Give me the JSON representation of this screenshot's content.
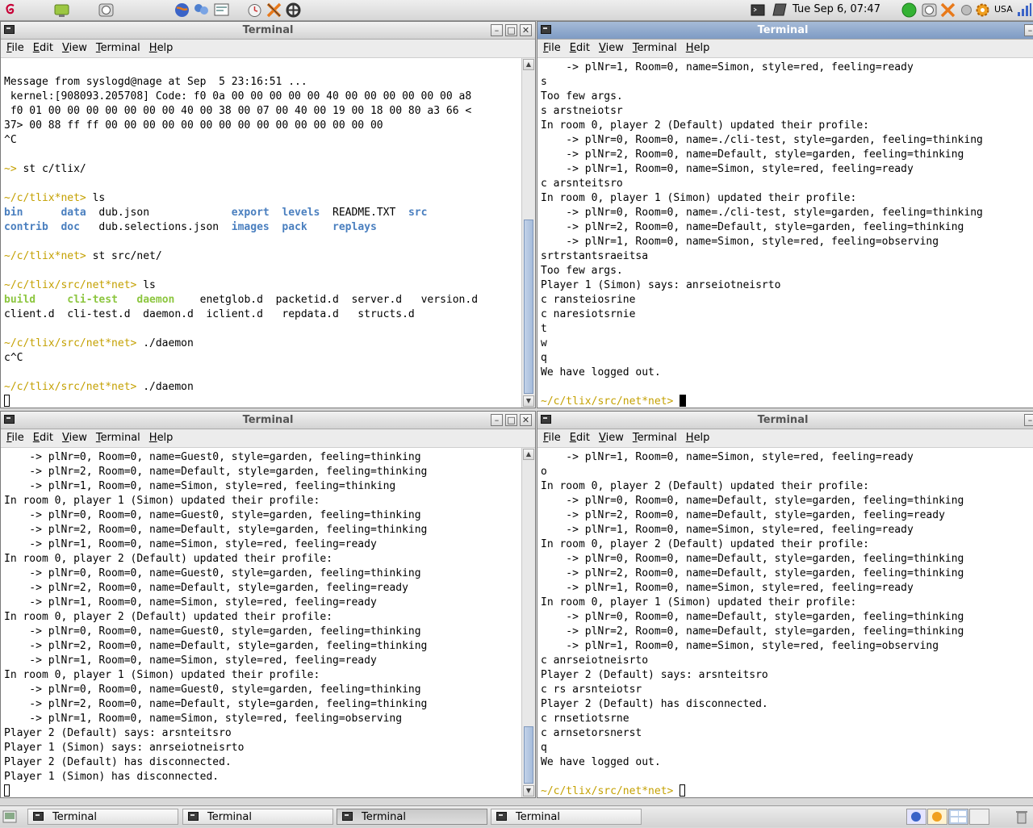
{
  "top_panel": {
    "clock": "Tue Sep  6, 07:47",
    "keyboard_layout": "USA",
    "launcher_icons": [
      "debian-menu-icon",
      "monitor-icon",
      "hardware-icon",
      "web-browser-icon",
      "chat-icon",
      "screenshot-icon",
      "timer-icon",
      "tools-icon",
      "fan-icon"
    ],
    "tray_icons": [
      "terminal-tray-icon",
      "notes-icon",
      "status-green-icon",
      "hardware-tray-icon",
      "tools-tray-icon",
      "bulb-icon",
      "settings-icon",
      "signal-icon"
    ]
  },
  "windows": [
    {
      "title": "Terminal",
      "menu": [
        "File",
        "Edit",
        "View",
        "Terminal",
        "Help"
      ],
      "lines": [
        [
          {
            "t": ""
          }
        ],
        [
          {
            "t": "Message from syslogd@nage at Sep  5 23:16:51 ..."
          }
        ],
        [
          {
            "t": " kernel:[908093.205708] Code: f0 0a 00 00 00 00 00 40 00 00 00 00 00 00 a8"
          }
        ],
        [
          {
            "t": " f0 01 00 00 00 00 00 00 00 40 00 38 00 07 00 40 00 19 00 18 00 80 a3 66 <"
          }
        ],
        [
          {
            "t": "37> 00 88 ff ff 00 00 00 00 00 00 00 00 00 00 00 00 00 00 00"
          }
        ],
        [
          {
            "t": "^C"
          }
        ],
        [
          {
            "t": ""
          }
        ],
        [
          {
            "t": "~> ",
            "c": "prompt"
          },
          {
            "t": "st c/tlix/"
          }
        ],
        [
          {
            "t": ""
          }
        ],
        [
          {
            "t": "~/c/tlix*net> ",
            "c": "prompt"
          },
          {
            "t": "ls"
          }
        ],
        [
          {
            "t": "bin",
            "c": "dir"
          },
          {
            "t": "      "
          },
          {
            "t": "data",
            "c": "dir"
          },
          {
            "t": "  dub.json             "
          },
          {
            "t": "export",
            "c": "dir"
          },
          {
            "t": "  "
          },
          {
            "t": "levels",
            "c": "dir"
          },
          {
            "t": "  README.TXT  "
          },
          {
            "t": "src",
            "c": "dir"
          }
        ],
        [
          {
            "t": "contrib",
            "c": "dir"
          },
          {
            "t": "  "
          },
          {
            "t": "doc",
            "c": "dir"
          },
          {
            "t": "   dub.selections.json  "
          },
          {
            "t": "images",
            "c": "dir"
          },
          {
            "t": "  "
          },
          {
            "t": "pack",
            "c": "dir"
          },
          {
            "t": "    "
          },
          {
            "t": "replays",
            "c": "dir"
          }
        ],
        [
          {
            "t": ""
          }
        ],
        [
          {
            "t": "~/c/tlix*net> ",
            "c": "prompt"
          },
          {
            "t": "st src/net/"
          }
        ],
        [
          {
            "t": ""
          }
        ],
        [
          {
            "t": "~/c/tlix/src/net*net> ",
            "c": "prompt"
          },
          {
            "t": "ls"
          }
        ],
        [
          {
            "t": "build",
            "c": "exe"
          },
          {
            "t": "     "
          },
          {
            "t": "cli-test",
            "c": "exe"
          },
          {
            "t": "   "
          },
          {
            "t": "daemon",
            "c": "exe"
          },
          {
            "t": "    enetglob.d  packetid.d  server.d   version.d"
          }
        ],
        [
          {
            "t": "client.d  cli-test.d  daemon.d  iclient.d   repdata.d   structs.d"
          }
        ],
        [
          {
            "t": ""
          }
        ],
        [
          {
            "t": "~/c/tlix/src/net*net> ",
            "c": "prompt"
          },
          {
            "t": "./daemon"
          }
        ],
        [
          {
            "t": "c^C"
          }
        ],
        [
          {
            "t": ""
          }
        ],
        [
          {
            "t": "~/c/tlix/src/net*net> ",
            "c": "prompt"
          },
          {
            "t": "./daemon"
          }
        ],
        [
          {
            "t": "",
            "cursor": "hollow"
          }
        ]
      ]
    },
    {
      "title": "Terminal",
      "menu": [
        "File",
        "Edit",
        "View",
        "Terminal",
        "Help"
      ],
      "lines": [
        [
          {
            "t": "    -> plNr=1, Room=0, name=Simon, style=red, feeling=ready"
          }
        ],
        [
          {
            "t": "s"
          }
        ],
        [
          {
            "t": "Too few args."
          }
        ],
        [
          {
            "t": "s arstneiotsr"
          }
        ],
        [
          {
            "t": "In room 0, player 2 (Default) updated their profile:"
          }
        ],
        [
          {
            "t": "    -> plNr=0, Room=0, name=./cli-test, style=garden, feeling=thinking"
          }
        ],
        [
          {
            "t": "    -> plNr=2, Room=0, name=Default, style=garden, feeling=thinking"
          }
        ],
        [
          {
            "t": "    -> plNr=1, Room=0, name=Simon, style=red, feeling=ready"
          }
        ],
        [
          {
            "t": "c arsnteitsro"
          }
        ],
        [
          {
            "t": "In room 0, player 1 (Simon) updated their profile:"
          }
        ],
        [
          {
            "t": "    -> plNr=0, Room=0, name=./cli-test, style=garden, feeling=thinking"
          }
        ],
        [
          {
            "t": "    -> plNr=2, Room=0, name=Default, style=garden, feeling=thinking"
          }
        ],
        [
          {
            "t": "    -> plNr=1, Room=0, name=Simon, style=red, feeling=observing"
          }
        ],
        [
          {
            "t": "srtrstantsraeitsa"
          }
        ],
        [
          {
            "t": "Too few args."
          }
        ],
        [
          {
            "t": "Player 1 (Simon) says: anrseiotneisrto"
          }
        ],
        [
          {
            "t": "c ransteiosrine"
          }
        ],
        [
          {
            "t": "c naresiotsrnie"
          }
        ],
        [
          {
            "t": "t"
          }
        ],
        [
          {
            "t": "w"
          }
        ],
        [
          {
            "t": "q"
          }
        ],
        [
          {
            "t": "We have logged out."
          }
        ],
        [
          {
            "t": ""
          }
        ],
        [
          {
            "t": "~/c/tlix/src/net*net> ",
            "c": "prompt"
          },
          {
            "t": "",
            "cursor": "block"
          }
        ]
      ]
    },
    {
      "title": "Terminal",
      "menu": [
        "File",
        "Edit",
        "View",
        "Terminal",
        "Help"
      ],
      "lines": [
        [
          {
            "t": "    -> plNr=0, Room=0, name=Guest0, style=garden, feeling=thinking"
          }
        ],
        [
          {
            "t": "    -> plNr=2, Room=0, name=Default, style=garden, feeling=thinking"
          }
        ],
        [
          {
            "t": "    -> plNr=1, Room=0, name=Simon, style=red, feeling=thinking"
          }
        ],
        [
          {
            "t": "In room 0, player 1 (Simon) updated their profile:"
          }
        ],
        [
          {
            "t": "    -> plNr=0, Room=0, name=Guest0, style=garden, feeling=thinking"
          }
        ],
        [
          {
            "t": "    -> plNr=2, Room=0, name=Default, style=garden, feeling=thinking"
          }
        ],
        [
          {
            "t": "    -> plNr=1, Room=0, name=Simon, style=red, feeling=ready"
          }
        ],
        [
          {
            "t": "In room 0, player 2 (Default) updated their profile:"
          }
        ],
        [
          {
            "t": "    -> plNr=0, Room=0, name=Guest0, style=garden, feeling=thinking"
          }
        ],
        [
          {
            "t": "    -> plNr=2, Room=0, name=Default, style=garden, feeling=ready"
          }
        ],
        [
          {
            "t": "    -> plNr=1, Room=0, name=Simon, style=red, feeling=ready"
          }
        ],
        [
          {
            "t": "In room 0, player 2 (Default) updated their profile:"
          }
        ],
        [
          {
            "t": "    -> plNr=0, Room=0, name=Guest0, style=garden, feeling=thinking"
          }
        ],
        [
          {
            "t": "    -> plNr=2, Room=0, name=Default, style=garden, feeling=thinking"
          }
        ],
        [
          {
            "t": "    -> plNr=1, Room=0, name=Simon, style=red, feeling=ready"
          }
        ],
        [
          {
            "t": "In room 0, player 1 (Simon) updated their profile:"
          }
        ],
        [
          {
            "t": "    -> plNr=0, Room=0, name=Guest0, style=garden, feeling=thinking"
          }
        ],
        [
          {
            "t": "    -> plNr=2, Room=0, name=Default, style=garden, feeling=thinking"
          }
        ],
        [
          {
            "t": "    -> plNr=1, Room=0, name=Simon, style=red, feeling=observing"
          }
        ],
        [
          {
            "t": "Player 2 (Default) says: arsnteitsro"
          }
        ],
        [
          {
            "t": "Player 1 (Simon) says: anrseiotneisrto"
          }
        ],
        [
          {
            "t": "Player 2 (Default) has disconnected."
          }
        ],
        [
          {
            "t": "Player 1 (Simon) has disconnected."
          }
        ],
        [
          {
            "t": "",
            "cursor": "hollow"
          }
        ]
      ]
    },
    {
      "title": "Terminal",
      "menu": [
        "File",
        "Edit",
        "View",
        "Terminal",
        "Help"
      ],
      "lines": [
        [
          {
            "t": "    -> plNr=1, Room=0, name=Simon, style=red, feeling=ready"
          }
        ],
        [
          {
            "t": "o"
          }
        ],
        [
          {
            "t": "In room 0, player 2 (Default) updated their profile:"
          }
        ],
        [
          {
            "t": "    -> plNr=0, Room=0, name=Default, style=garden, feeling=thinking"
          }
        ],
        [
          {
            "t": "    -> plNr=2, Room=0, name=Default, style=garden, feeling=ready"
          }
        ],
        [
          {
            "t": "    -> plNr=1, Room=0, name=Simon, style=red, feeling=ready"
          }
        ],
        [
          {
            "t": "In room 0, player 2 (Default) updated their profile:"
          }
        ],
        [
          {
            "t": "    -> plNr=0, Room=0, name=Default, style=garden, feeling=thinking"
          }
        ],
        [
          {
            "t": "    -> plNr=2, Room=0, name=Default, style=garden, feeling=thinking"
          }
        ],
        [
          {
            "t": "    -> plNr=1, Room=0, name=Simon, style=red, feeling=ready"
          }
        ],
        [
          {
            "t": "In room 0, player 1 (Simon) updated their profile:"
          }
        ],
        [
          {
            "t": "    -> plNr=0, Room=0, name=Default, style=garden, feeling=thinking"
          }
        ],
        [
          {
            "t": "    -> plNr=2, Room=0, name=Default, style=garden, feeling=thinking"
          }
        ],
        [
          {
            "t": "    -> plNr=1, Room=0, name=Simon, style=red, feeling=observing"
          }
        ],
        [
          {
            "t": "c anrseiotneisrto"
          }
        ],
        [
          {
            "t": "Player 2 (Default) says: arsnteitsro"
          }
        ],
        [
          {
            "t": "c rs arsnteiotsr"
          }
        ],
        [
          {
            "t": "Player 2 (Default) has disconnected."
          }
        ],
        [
          {
            "t": "c rnsetiotsrne"
          }
        ],
        [
          {
            "t": "c arnsetorsnerst"
          }
        ],
        [
          {
            "t": "q"
          }
        ],
        [
          {
            "t": "We have logged out."
          }
        ],
        [
          {
            "t": ""
          }
        ],
        [
          {
            "t": "~/c/tlix/src/net*net> ",
            "c": "prompt"
          },
          {
            "t": "",
            "cursor": "hollow"
          }
        ]
      ]
    }
  ],
  "taskbar": {
    "tasks": [
      {
        "label": "Terminal",
        "active": false
      },
      {
        "label": "Terminal",
        "active": false
      },
      {
        "label": "Terminal",
        "active": true
      },
      {
        "label": "Terminal",
        "active": false
      }
    ],
    "workspaces": 4
  },
  "colors": {
    "prompt": "#c4a000",
    "directory": "#4a7fbf",
    "executable": "#8cc63f",
    "active_title": "#7e9bc4"
  }
}
